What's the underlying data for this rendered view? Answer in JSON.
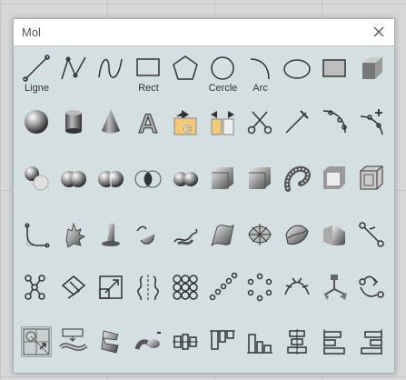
{
  "window": {
    "title": "Mol",
    "close_icon": "close-icon"
  },
  "toolbar": {
    "rows": [
      [
        {
          "name": "line-tool",
          "icon": "line-icon",
          "label": "Ligne"
        },
        {
          "name": "polyline-tool",
          "icon": "polyline-icon",
          "label": ""
        },
        {
          "name": "curve-tool",
          "icon": "curve-icon",
          "label": ""
        },
        {
          "name": "rectangle-tool",
          "icon": "rectangle-icon",
          "label": "Rect"
        },
        {
          "name": "polygon-tool",
          "icon": "polygon-icon",
          "label": ""
        },
        {
          "name": "circle-tool",
          "icon": "circle-icon",
          "label": "Cercle"
        },
        {
          "name": "arc-tool",
          "icon": "arc-icon",
          "label": "Arc"
        },
        {
          "name": "ellipse-tool",
          "icon": "ellipse-icon",
          "label": ""
        },
        {
          "name": "plane-tool",
          "icon": "plane-icon",
          "label": ""
        },
        {
          "name": "box-tool",
          "icon": "box-icon",
          "label": ""
        }
      ],
      [
        {
          "name": "sphere-tool",
          "icon": "sphere-icon",
          "label": ""
        },
        {
          "name": "cylinder-tool",
          "icon": "cylinder-icon",
          "label": ""
        },
        {
          "name": "cone-tool",
          "icon": "cone-icon",
          "label": ""
        },
        {
          "name": "text-object-tool",
          "icon": "text-object-icon",
          "label": ""
        },
        {
          "name": "join-tool",
          "icon": "join-icon",
          "label": ""
        },
        {
          "name": "explode-tool",
          "icon": "explode-icon",
          "label": ""
        },
        {
          "name": "trim-tool",
          "icon": "scissors-icon",
          "label": ""
        },
        {
          "name": "split-tool",
          "icon": "split-icon",
          "label": ""
        },
        {
          "name": "rebuild-tool",
          "icon": "rebuild-icon",
          "label": ""
        },
        {
          "name": "add-point-tool",
          "icon": "add-point-icon",
          "label": ""
        }
      ],
      [
        {
          "name": "boolean-split-tool",
          "icon": "boolean-split-icon",
          "label": ""
        },
        {
          "name": "boolean-union-tool",
          "icon": "boolean-union-icon",
          "label": ""
        },
        {
          "name": "boolean-difference-tool",
          "icon": "boolean-difference-icon",
          "label": ""
        },
        {
          "name": "boolean-intersection-tool",
          "icon": "boolean-intersection-icon",
          "label": ""
        },
        {
          "name": "boolean-two-objects-tool",
          "icon": "boolean-two-objects-icon",
          "label": ""
        },
        {
          "name": "fillet-edge-tool",
          "icon": "fillet-edge-icon",
          "label": ""
        },
        {
          "name": "chamfer-edge-tool",
          "icon": "chamfer-edge-icon",
          "label": ""
        },
        {
          "name": "pipe-tool",
          "icon": "pipe-icon",
          "label": ""
        },
        {
          "name": "shell-tool",
          "icon": "shell-icon",
          "label": ""
        },
        {
          "name": "wireframe-box-tool",
          "icon": "wireframe-box-icon",
          "label": ""
        }
      ],
      [
        {
          "name": "fillet-curve-tool",
          "icon": "fillet-curve-icon",
          "label": ""
        },
        {
          "name": "extrude-tool",
          "icon": "extrude-icon",
          "label": ""
        },
        {
          "name": "revolve-tool",
          "icon": "revolve-icon",
          "label": ""
        },
        {
          "name": "sweep-one-rail-tool",
          "icon": "sweep-one-rail-icon",
          "label": ""
        },
        {
          "name": "sweep-two-rails-tool",
          "icon": "sweep-two-rails-icon",
          "label": ""
        },
        {
          "name": "loft-tool",
          "icon": "loft-icon",
          "label": ""
        },
        {
          "name": "network-surface-tool",
          "icon": "network-surface-icon",
          "label": ""
        },
        {
          "name": "patch-tool",
          "icon": "patch-icon",
          "label": ""
        },
        {
          "name": "blend-surface-tool",
          "icon": "blend-surface-icon",
          "label": ""
        },
        {
          "name": "control-points-tool",
          "icon": "control-points-icon",
          "label": ""
        }
      ],
      [
        {
          "name": "point-edit-tool",
          "icon": "point-edit-icon",
          "label": ""
        },
        {
          "name": "project-tool",
          "icon": "project-icon",
          "label": ""
        },
        {
          "name": "scale-tool",
          "icon": "scale-icon",
          "label": ""
        },
        {
          "name": "mirror-tool",
          "icon": "mirror-icon",
          "label": ""
        },
        {
          "name": "rectangular-array-tool",
          "icon": "rectangular-array-icon",
          "label": ""
        },
        {
          "name": "linear-array-tool",
          "icon": "linear-array-icon",
          "label": ""
        },
        {
          "name": "polar-array-tool",
          "icon": "polar-array-icon",
          "label": ""
        },
        {
          "name": "curve-array-tool",
          "icon": "curve-array-icon",
          "label": ""
        },
        {
          "name": "gumball-tool",
          "icon": "gumball-icon",
          "label": ""
        },
        {
          "name": "orient-tool",
          "icon": "orient-icon",
          "label": ""
        }
      ],
      [
        {
          "name": "cage-edit-tool",
          "icon": "cage-edit-icon",
          "label": "",
          "selected": true
        },
        {
          "name": "flow-along-curve-tool",
          "icon": "flow-along-curve-icon",
          "label": ""
        },
        {
          "name": "twist-tool",
          "icon": "twist-icon",
          "label": ""
        },
        {
          "name": "bend-tool",
          "icon": "bend-icon",
          "label": ""
        },
        {
          "name": "align-horizontal-center-tool",
          "icon": "align-horizontal-center-icon",
          "label": ""
        },
        {
          "name": "align-top-tool",
          "icon": "align-top-icon",
          "label": ""
        },
        {
          "name": "align-bottom-tool",
          "icon": "align-bottom-icon",
          "label": ""
        },
        {
          "name": "align-vertical-center-tool",
          "icon": "align-vertical-center-icon",
          "label": ""
        },
        {
          "name": "align-left-tool",
          "icon": "align-left-icon",
          "label": ""
        },
        {
          "name": "align-right-tool",
          "icon": "align-right-icon",
          "label": ""
        }
      ]
    ]
  }
}
